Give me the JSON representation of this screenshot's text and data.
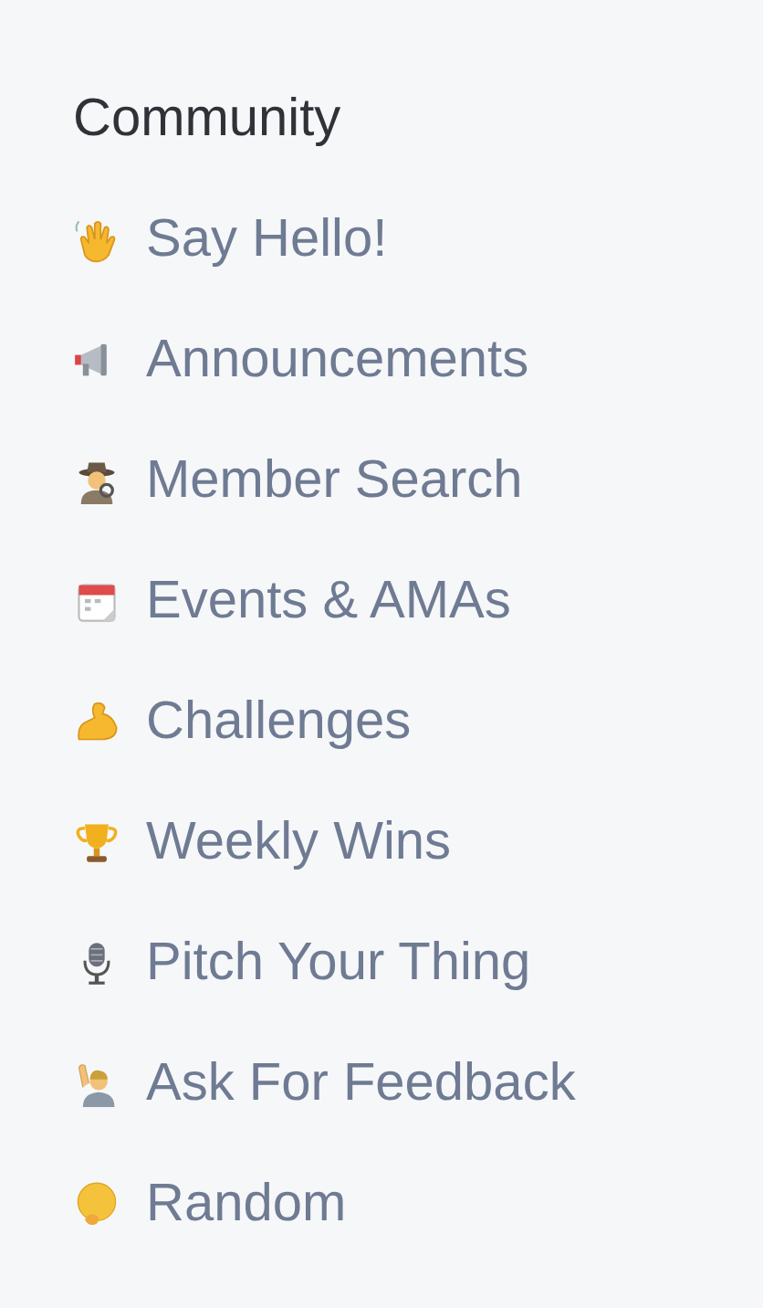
{
  "section": {
    "title": "Community",
    "items": [
      {
        "label": "Say Hello!"
      },
      {
        "label": "Announcements"
      },
      {
        "label": "Member Search"
      },
      {
        "label": "Events & AMAs"
      },
      {
        "label": "Challenges"
      },
      {
        "label": "Weekly Wins"
      },
      {
        "label": "Pitch Your Thing"
      },
      {
        "label": "Ask For Feedback"
      },
      {
        "label": "Random"
      }
    ]
  }
}
